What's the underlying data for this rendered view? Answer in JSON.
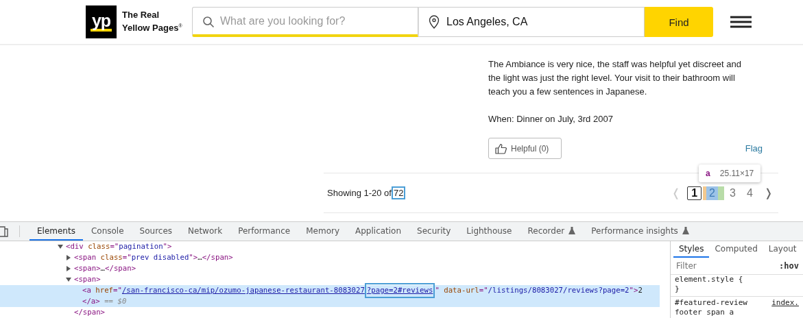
{
  "header": {
    "logo_mark": "yp",
    "logo_text": [
      "The Real",
      "Yellow Pages"
    ],
    "logo_sup": "®",
    "search": {
      "placeholder": "What are you looking for?"
    },
    "location": {
      "value": "Los Angeles, CA"
    },
    "find_button": "Find"
  },
  "review": {
    "paragraph": "The Ambiance is very nice, the staff was helpful yet discreet and the light was just the right level. Your visit to their bathroom will teach you a few sentences in Japanese.",
    "when": "When: Dinner on July, 3rd 2007",
    "helpful": "Helpful (0)",
    "flag": "Flag"
  },
  "pagination": {
    "showing": "Showing 1-20 of",
    "total": "72",
    "prev": "❬",
    "next": "❭",
    "tooltip": {
      "tag": "a",
      "size": "25.11×17"
    },
    "pages": [
      {
        "label": "1",
        "selected": true,
        "inspected": false
      },
      {
        "label": "2",
        "selected": false,
        "inspected": true
      },
      {
        "label": "3",
        "selected": false,
        "inspected": false
      },
      {
        "label": "4",
        "selected": false,
        "inspected": false
      }
    ]
  },
  "devtools": {
    "tabs": [
      {
        "label": "Elements",
        "selected": true,
        "experimental": false
      },
      {
        "label": "Console",
        "selected": false,
        "experimental": false
      },
      {
        "label": "Sources",
        "selected": false,
        "experimental": false
      },
      {
        "label": "Network",
        "selected": false,
        "experimental": false
      },
      {
        "label": "Performance",
        "selected": false,
        "experimental": false
      },
      {
        "label": "Memory",
        "selected": false,
        "experimental": false
      },
      {
        "label": "Application",
        "selected": false,
        "experimental": false
      },
      {
        "label": "Security",
        "selected": false,
        "experimental": false
      },
      {
        "label": "Lighthouse",
        "selected": false,
        "experimental": false
      },
      {
        "label": "Recorder",
        "selected": false,
        "experimental": true
      },
      {
        "label": "Performance insights",
        "selected": false,
        "experimental": true
      }
    ],
    "dom_tree": [
      {
        "expanded": true,
        "selected": false,
        "tokens": [
          {
            "kind": "tag",
            "text": "<div "
          },
          {
            "kind": "attr",
            "text": "class"
          },
          {
            "kind": "tag",
            "text": "=\""
          },
          {
            "kind": "value",
            "text": "pagination"
          },
          {
            "kind": "tag",
            "text": "\">"
          }
        ],
        "children": [
          {
            "expanded": false,
            "selected": false,
            "tokens": [
              {
                "kind": "tag",
                "text": "<span "
              },
              {
                "kind": "attr",
                "text": "class"
              },
              {
                "kind": "tag",
                "text": "=\""
              },
              {
                "kind": "value",
                "text": "prev disabled"
              },
              {
                "kind": "tag",
                "text": "\">"
              },
              {
                "kind": "text",
                "text": "…"
              },
              {
                "kind": "tag",
                "text": "</span>"
              }
            ]
          },
          {
            "expanded": false,
            "selected": false,
            "tokens": [
              {
                "kind": "tag",
                "text": "<span>"
              },
              {
                "kind": "text",
                "text": "…"
              },
              {
                "kind": "tag",
                "text": "</span>"
              }
            ]
          },
          {
            "expanded": true,
            "selected": false,
            "tokens": [
              {
                "kind": "tag",
                "text": "<span>"
              }
            ],
            "children": [
              {
                "selected": true,
                "tokens": [
                  {
                    "kind": "tag",
                    "text": "<a "
                  },
                  {
                    "kind": "attr",
                    "text": "href"
                  },
                  {
                    "kind": "tag",
                    "text": "=\""
                  },
                  {
                    "kind": "link",
                    "text": "/san-francisco-ca/mip/ozumo-japanese-restaurant-8083027"
                  },
                  {
                    "kind": "boxedlink",
                    "text": "?page=2#reviews"
                  },
                  {
                    "kind": "tag",
                    "text": "\" "
                  },
                  {
                    "kind": "attr",
                    "text": "data-url"
                  },
                  {
                    "kind": "tag",
                    "text": "=\""
                  },
                  {
                    "kind": "value",
                    "text": "/listings/8083027/reviews?page=2"
                  },
                  {
                    "kind": "tag",
                    "text": "\">"
                  },
                  {
                    "kind": "text",
                    "text": "2"
                  }
                ],
                "closing": [
                  {
                    "kind": "tag",
                    "text": "</a>"
                  },
                  {
                    "kind": "note",
                    "text": " == $0"
                  }
                ]
              }
            ],
            "closing": [
              {
                "kind": "tag",
                "text": "</span>"
              }
            ]
          }
        ]
      }
    ],
    "styles_tabs": [
      {
        "label": "Styles",
        "selected": true
      },
      {
        "label": "Computed",
        "selected": false
      },
      {
        "label": "Layout",
        "selected": false
      }
    ],
    "filter": {
      "placeholder": "Filter"
    },
    "hov": ":hov",
    "rules": [
      {
        "kind": "selector",
        "text": "element.style {"
      },
      {
        "kind": "selector",
        "text": "}"
      },
      {
        "kind": "source",
        "text": "#featured-review",
        "source": "index."
      },
      {
        "kind": "selector",
        "text": "footer span a"
      }
    ]
  }
}
